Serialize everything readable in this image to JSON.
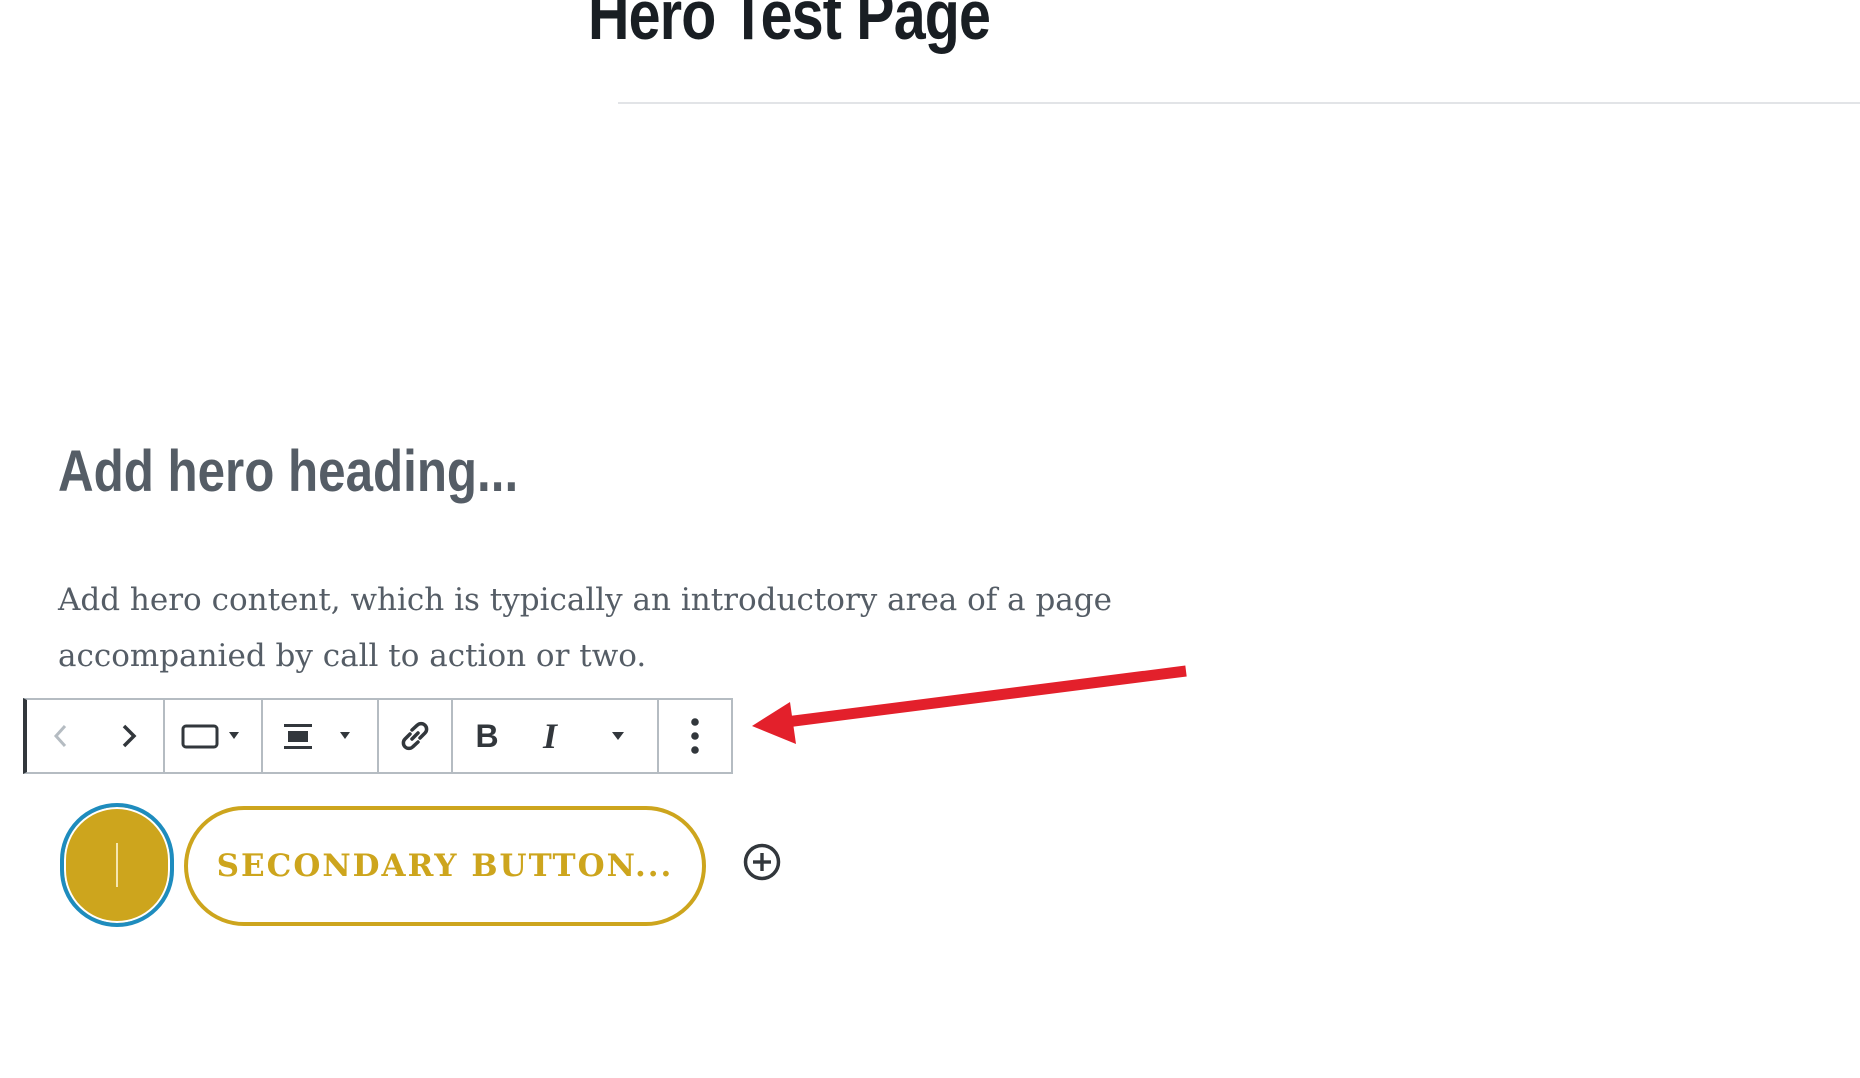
{
  "page": {
    "title": "Hero Test Page"
  },
  "hero": {
    "heading_placeholder": "Add hero heading...",
    "content_placeholder": "Add hero content, which is typically an introductory area of a page accompanied by call to action or two."
  },
  "toolbar": {
    "bold_label": "B",
    "italic_label": "I",
    "items": [
      {
        "name": "move-left",
        "icon": "chevron-left-icon",
        "enabled": false
      },
      {
        "name": "move-right",
        "icon": "chevron-right-icon",
        "enabled": true
      },
      {
        "name": "button-style",
        "icon": "rectangle-icon",
        "dropdown": true
      },
      {
        "name": "alignment",
        "icon": "align-center-icon",
        "dropdown": true
      },
      {
        "name": "link",
        "icon": "link-icon"
      },
      {
        "name": "bold",
        "icon": "bold-icon"
      },
      {
        "name": "italic",
        "icon": "italic-icon"
      },
      {
        "name": "more-formatting",
        "icon": "caret-down-icon"
      },
      {
        "name": "more-options",
        "icon": "vertical-ellipsis-icon"
      }
    ]
  },
  "buttons": {
    "primary_text": "",
    "secondary_text": "SECONDARY BUTTON..."
  },
  "colors": {
    "accent_gold": "#cda51d",
    "focus_blue": "#1e8cbe",
    "annotation_red": "#e3202b",
    "title_text": "#191e23",
    "body_text": "#555d66"
  }
}
